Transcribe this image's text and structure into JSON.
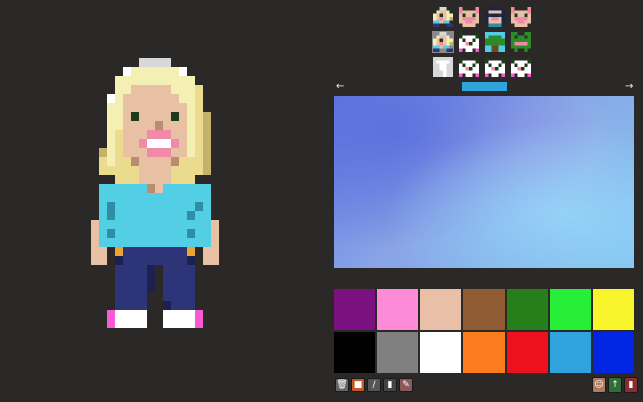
{
  "app": {
    "title": ""
  },
  "editor": {
    "palette_colors": [
      "#7b1080",
      "#fd8bd7",
      "#e9c0a7",
      "#8e5b33",
      "#267f1a",
      "#27ef38",
      "#f8f42b",
      "#000000",
      "#808080",
      "#ffffff",
      "#fc7d1e",
      "#ed111e",
      "#2fa3dc",
      "#0026e3"
    ],
    "sprite_colors": {
      "hair_light": "#f4efb3",
      "hair": "#eadb8e",
      "hair_shadow": "#c4b26c",
      "hair_white": "#ffffff",
      "hair_grey": "#d8d8d8",
      "skin": "#e8c0a3",
      "skin_shadow": "#b88d71",
      "eye": "#1d3b1a",
      "mouth": "#ffffff",
      "lip": "#f08aa8",
      "shirt": "#53cfe5",
      "shirt_shadow": "#2e8ea3",
      "pants": "#2d3478",
      "pants_shadow": "#1d2150",
      "belt": "#f0a230",
      "shoe": "#ffffff",
      "shoe_accent": "#f85ad6"
    },
    "selected_thumb_index": 4
  },
  "thumbnails": [
    {
      "icon": "blonde-woman-icon"
    },
    {
      "icon": "pig-icon"
    },
    {
      "icon": "robot-icon"
    },
    {
      "icon": "pig-icon"
    },
    {
      "icon": "blonde-woman-icon"
    },
    {
      "icon": "panda-icon"
    },
    {
      "icon": "tree-icon"
    },
    {
      "icon": "frog-icon"
    },
    {
      "icon": "tornado-icon"
    },
    {
      "icon": "panda-icon"
    },
    {
      "icon": "panda-icon"
    },
    {
      "icon": "panda-icon"
    }
  ],
  "nav": {
    "left_arrow": "←",
    "right_arrow": "→"
  },
  "tools": [
    {
      "name": "trash-icon",
      "glyph": "🗑",
      "color": "#666666"
    },
    {
      "name": "fill-bucket-icon",
      "glyph": "■",
      "color": "#c35a2a"
    },
    {
      "name": "pencil-icon",
      "glyph": "/",
      "color": "#555555"
    },
    {
      "name": "eyedropper-icon",
      "glyph": "▮",
      "color": "#444444"
    },
    {
      "name": "brush-icon",
      "glyph": "✎",
      "color": "#8a5a5a"
    }
  ],
  "actions": [
    {
      "name": "avatar-icon",
      "glyph": "☺",
      "color": "#b07a60"
    },
    {
      "name": "export-icon",
      "glyph": "↑",
      "color": "#2f6e3a"
    },
    {
      "name": "delete-icon",
      "glyph": "▮",
      "color": "#8a2d2d"
    }
  ]
}
